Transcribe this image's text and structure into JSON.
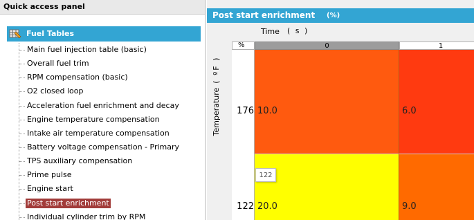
{
  "quick_access": {
    "title": "Quick access panel",
    "group": {
      "label": "Fuel Tables",
      "icon": "fuel-tables-icon"
    },
    "items": [
      {
        "label": "Main fuel injection table (basic)"
      },
      {
        "label": "Overall fuel trim"
      },
      {
        "label": "RPM compensation (basic)"
      },
      {
        "label": "O2 closed loop"
      },
      {
        "label": "Acceleration fuel enrichment and decay"
      },
      {
        "label": "Engine temperature compensation"
      },
      {
        "label": "Intake air temperature compensation"
      },
      {
        "label": "Battery voltage compensation - Primary"
      },
      {
        "label": "TPS auxiliary compensation"
      },
      {
        "label": "Prime pulse"
      },
      {
        "label": "Engine start"
      },
      {
        "label": "Post start enrichment",
        "selected": true
      },
      {
        "label": "Individual cylinder trim by RPM"
      }
    ]
  },
  "table_panel": {
    "title": "Post start enrichment",
    "unit": "(%)",
    "x_axis": {
      "label": "Time",
      "unit": "( s )"
    },
    "y_axis": {
      "label": "Temperature",
      "unit": "( ºF )"
    },
    "corner": "%",
    "columns": [
      "0",
      "1"
    ],
    "rows": [
      {
        "label": "176",
        "cells": [
          "10.0",
          "6.0"
        ]
      },
      {
        "label": "122",
        "cells": [
          "20.0",
          "9.0"
        ]
      }
    ],
    "tooltip": "122",
    "colors": {
      "header_bg": "#33a5d3",
      "selected_item_bg": "#a23c3a",
      "cell_176_0": "#ff5a0f",
      "cell_176_1": "#ff3a10",
      "cell_122_0": "#ffff00",
      "cell_122_1": "#ff6a00"
    }
  }
}
